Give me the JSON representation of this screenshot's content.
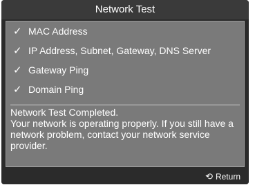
{
  "window": {
    "title": "Network Test"
  },
  "checks": [
    {
      "icon": "checkmark-icon",
      "label": "MAC Address"
    },
    {
      "icon": "checkmark-icon",
      "label": "IP Address, Subnet, Gateway, DNS Server"
    },
    {
      "icon": "checkmark-icon",
      "label": "Gateway Ping"
    },
    {
      "icon": "checkmark-icon",
      "label": "Domain Ping"
    }
  ],
  "status": {
    "headline": "Network Test Completed.",
    "message": "Your network is operating properly. If you still have a network problem, contact your network service provider."
  },
  "footer": {
    "return_label": "Return",
    "return_icon": "return-icon"
  },
  "colors": {
    "background": "#2b2b2b",
    "panel": "#7a7a7a",
    "text": "#ffffff"
  }
}
